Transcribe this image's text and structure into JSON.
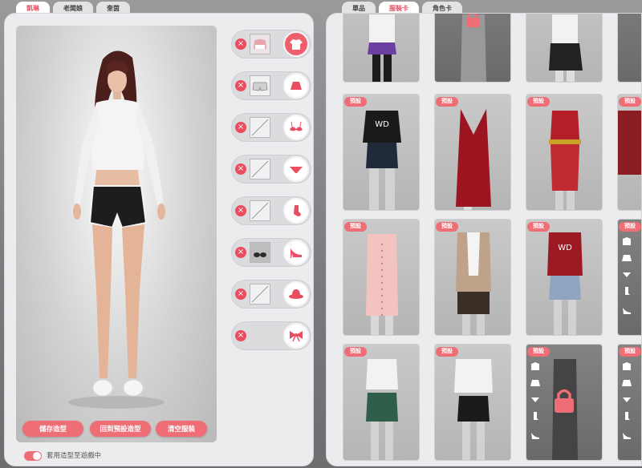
{
  "left_tabs": [
    {
      "label": "凱琳",
      "active": true
    },
    {
      "label": "老闆娘",
      "active": false
    },
    {
      "label": "奎茵",
      "active": false
    }
  ],
  "right_tabs": [
    {
      "label": "單品",
      "active": false
    },
    {
      "label": "服裝卡",
      "active": true
    },
    {
      "label": "角色卡",
      "active": false
    }
  ],
  "slots": [
    {
      "category": "top-icon",
      "thumb": "white-top"
    },
    {
      "category": "skirt-icon",
      "thumb": "shorts"
    },
    {
      "category": "bra-icon",
      "thumb": "empty"
    },
    {
      "category": "panties-icon",
      "thumb": "empty"
    },
    {
      "category": "sock-icon",
      "thumb": "empty"
    },
    {
      "category": "heel-icon",
      "thumb": "sneakers"
    },
    {
      "category": "hat-icon",
      "thumb": "empty"
    },
    {
      "category": "bow-icon",
      "thumb": "none"
    }
  ],
  "actions": {
    "save": "儲存造型",
    "reset": "回到預設造型",
    "clear": "清空服裝"
  },
  "toggle": {
    "label": "套用造型至遊戲中",
    "on": true
  },
  "cards": {
    "badge": "預設",
    "items": [
      {
        "id": "r0c0",
        "locked": false,
        "badge": false
      },
      {
        "id": "r0c1",
        "locked": true,
        "badge": false
      },
      {
        "id": "r0c2",
        "locked": false,
        "badge": false
      },
      {
        "id": "r1c0",
        "locked": false,
        "badge": true
      },
      {
        "id": "r1c1",
        "locked": false,
        "badge": true
      },
      {
        "id": "r1c2",
        "locked": false,
        "badge": true
      },
      {
        "id": "r2c0",
        "locked": false,
        "badge": true
      },
      {
        "id": "r2c1",
        "locked": false,
        "badge": true
      },
      {
        "id": "r2c2",
        "locked": false,
        "badge": true
      },
      {
        "id": "r3c0",
        "locked": false,
        "badge": true
      },
      {
        "id": "r3c1",
        "locked": false,
        "badge": true
      },
      {
        "id": "r3c2",
        "locked": true,
        "badge": true
      }
    ]
  },
  "colors": {
    "accent": "#ef6d75",
    "accent_dark": "#ea4d5f",
    "panel": "#ececee"
  }
}
